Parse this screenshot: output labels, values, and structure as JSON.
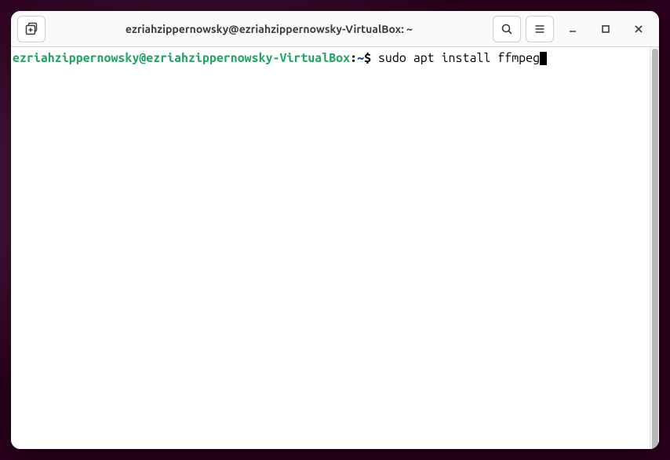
{
  "titlebar": {
    "title": "ezriahzippernowsky@ezriahzippernowsky-VirtualBox: ~"
  },
  "terminal": {
    "prompt_user_host": "ezriahzippernowsky@ezriahzippernowsky-VirtualBox",
    "prompt_colon": ":",
    "prompt_path": "~",
    "prompt_dollar": "$",
    "command": " sudo apt install ffmpeg"
  }
}
